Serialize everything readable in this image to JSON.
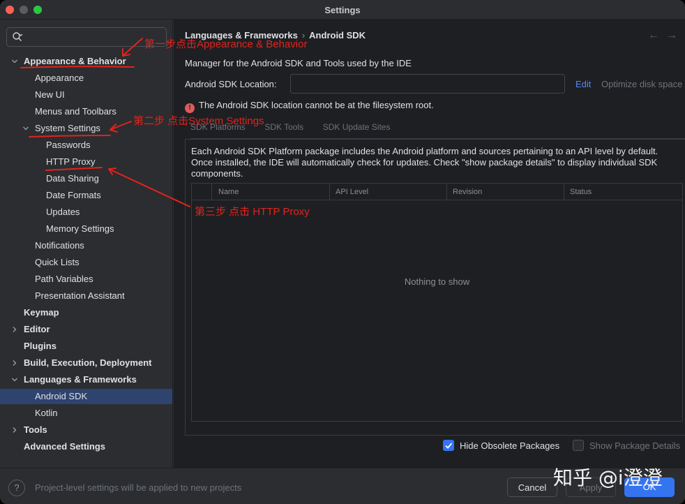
{
  "window": {
    "title": "Settings"
  },
  "sidebar": {
    "search_placeholder": "",
    "items": [
      {
        "label": "Appearance & Behavior",
        "level": 0,
        "bold": true,
        "expanded": true
      },
      {
        "label": "Appearance",
        "level": 1
      },
      {
        "label": "New UI",
        "level": 1
      },
      {
        "label": "Menus and Toolbars",
        "level": 1
      },
      {
        "label": "System Settings",
        "level": 1,
        "expanded": true
      },
      {
        "label": "Passwords",
        "level": 2
      },
      {
        "label": "HTTP Proxy",
        "level": 2
      },
      {
        "label": "Data Sharing",
        "level": 2
      },
      {
        "label": "Date Formats",
        "level": 2
      },
      {
        "label": "Updates",
        "level": 2
      },
      {
        "label": "Memory Settings",
        "level": 2
      },
      {
        "label": "Notifications",
        "level": 1
      },
      {
        "label": "Quick Lists",
        "level": 1
      },
      {
        "label": "Path Variables",
        "level": 1
      },
      {
        "label": "Presentation Assistant",
        "level": 1
      },
      {
        "label": "Keymap",
        "level": 0,
        "bold": true
      },
      {
        "label": "Editor",
        "level": 0,
        "bold": true,
        "expanded": false
      },
      {
        "label": "Plugins",
        "level": 0,
        "bold": true
      },
      {
        "label": "Build, Execution, Deployment",
        "level": 0,
        "bold": true,
        "expanded": false
      },
      {
        "label": "Languages & Frameworks",
        "level": 0,
        "bold": true,
        "expanded": true
      },
      {
        "label": "Android SDK",
        "level": 1,
        "selected": true
      },
      {
        "label": "Kotlin",
        "level": 1
      },
      {
        "label": "Tools",
        "level": 0,
        "bold": true,
        "expanded": false
      },
      {
        "label": "Advanced Settings",
        "level": 0,
        "bold": true
      }
    ]
  },
  "main": {
    "breadcrumb": [
      "Languages & Frameworks",
      "Android SDK"
    ],
    "breadcrumb_sep": "›",
    "nav_back": "←",
    "nav_forward": "→",
    "description": "Manager for the Android SDK and Tools used by the IDE",
    "sdk_location_label": "Android SDK Location:",
    "sdk_location_value": "",
    "edit_label": "Edit",
    "optimize_label": "Optimize disk space",
    "error_text": "The Android SDK location cannot be at the filesystem root.",
    "tabs": [
      "SDK Platforms",
      "SDK Tools",
      "SDK Update Sites"
    ],
    "panel_description": "Each Android SDK Platform package includes the Android platform and sources pertaining to an API level by default. Once installed, the IDE will automatically check for updates. Check \"show package details\" to display individual SDK components.",
    "table_columns": [
      "Name",
      "API Level",
      "Revision",
      "Status"
    ],
    "empty_text": "Nothing to show",
    "hide_obsolete_label": "Hide Obsolete Packages",
    "hide_obsolete_checked": true,
    "show_details_label": "Show Package Details",
    "show_details_checked": false
  },
  "footer": {
    "help_label": "?",
    "note": "Project-level settings will be applied to new projects",
    "cancel_label": "Cancel",
    "apply_label": "Apply",
    "ok_label": "OK"
  },
  "annotations": {
    "step1": "第一步点击Appearance & Behavior",
    "step2": "第二步 点击System Settings",
    "step3": "第三步 点击 HTTP Proxy"
  },
  "watermark": "知乎 @i澄澄",
  "colors": {
    "accent": "#3574f0",
    "selection": "#2e436e",
    "link": "#548af7",
    "error": "#db5c5c",
    "annotation": "#e3231e"
  }
}
